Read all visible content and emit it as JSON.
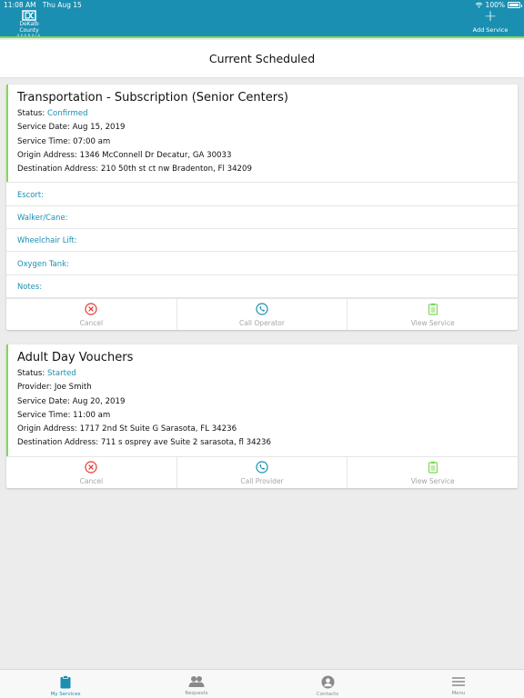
{
  "status_bar": {
    "time": "11:08 AM",
    "date": "Thu Aug 15",
    "battery": "100%"
  },
  "header": {
    "logo_text": "DeKalb County",
    "logo_sub": "GEORGIA",
    "add_service_label": "Add Service"
  },
  "page": {
    "title": "Current Scheduled"
  },
  "cards": [
    {
      "title": "Transportation - Subscription (Senior Centers)",
      "fields": [
        {
          "label": "Status:",
          "value": "Confirmed",
          "accent": true
        },
        {
          "label": "Service Date:",
          "value": "Aug 15, 2019"
        },
        {
          "label": "Service Time:",
          "value": "07:00 am"
        },
        {
          "label": "Origin Address:",
          "value": "1346 McConnell Dr Decatur, GA 30033"
        },
        {
          "label": "Destination Address:",
          "value": "210 50th st ct nw Bradenton, Fl 34209"
        }
      ],
      "extras": [
        "Escort:",
        "Walker/Cane:",
        "Wheelchair Lift:",
        "Oxygen Tank:",
        "Notes:"
      ],
      "actions": [
        "Cancel",
        "Call Operator",
        "View Service"
      ]
    },
    {
      "title": "Adult Day Vouchers",
      "fields": [
        {
          "label": "Status:",
          "value": "Started",
          "accent": true
        },
        {
          "label": "Provider:",
          "value": "Joe Smith"
        },
        {
          "label": "Service Date:",
          "value": "Aug 20, 2019"
        },
        {
          "label": "Service Time:",
          "value": "11:00 am"
        },
        {
          "label": "Origin Address:",
          "value": "1717 2nd St Suite G Sarasota, FL 34236"
        },
        {
          "label": "Destination Address:",
          "value": "711 s osprey ave Suite 2 sarasota, fl 34236"
        }
      ],
      "actions": [
        "Cancel",
        "Call Provider",
        "View Service"
      ]
    }
  ],
  "tabs": [
    {
      "label": "My Services",
      "icon": "clipboard-icon",
      "active": true
    },
    {
      "label": "Requests",
      "icon": "people-icon",
      "active": false
    },
    {
      "label": "Contacts",
      "icon": "person-circle-icon",
      "active": false
    },
    {
      "label": "Menu",
      "icon": "hamburger-icon",
      "active": false
    }
  ],
  "colors": {
    "primary": "#1a8fb2",
    "accent_green": "#7ed957",
    "cancel_red": "#e53935",
    "muted": "#a5a5a5"
  }
}
